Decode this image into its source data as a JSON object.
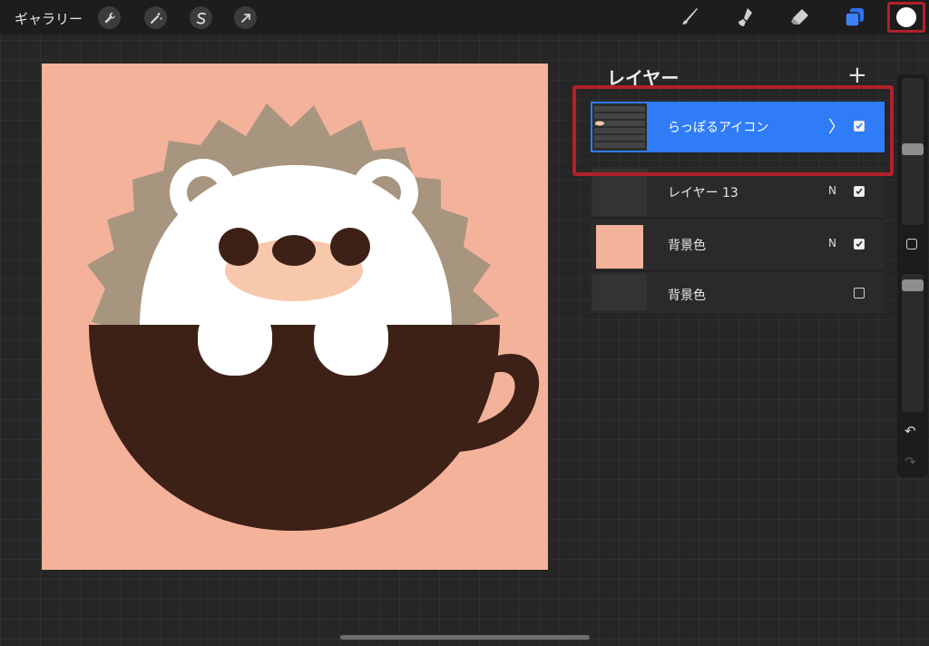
{
  "toolbar": {
    "gallery_label": "ギャラリー",
    "left_tools": [
      "wrench-icon",
      "magic-wand-icon",
      "selection-icon",
      "transform-arrow-icon"
    ],
    "right_tools": [
      "brush-icon",
      "smudge-icon",
      "eraser-icon",
      "layers-icon"
    ],
    "active_tool": "layers-icon",
    "current_color": "#ffffff"
  },
  "layers_panel": {
    "title": "レイヤー",
    "add_label": "+",
    "layers": [
      {
        "name": "らっぽるアイコン",
        "blend": "",
        "checked": true,
        "active": true,
        "type": "group"
      },
      {
        "name": "レイヤー 13",
        "blend": "N",
        "checked": true,
        "active": false,
        "type": "empty"
      },
      {
        "name": "背景色",
        "blend": "N",
        "checked": true,
        "active": false,
        "type": "fill",
        "fill": "#f4b29b"
      },
      {
        "name": "背景色",
        "blend": "",
        "checked": false,
        "active": false,
        "type": "empty"
      }
    ]
  },
  "canvas": {
    "background": "#f4b29b",
    "colors": {
      "spikes": "#a8957f",
      "body": "#ffffff",
      "snout": "#f7c8ac",
      "cup": "#3d2016"
    }
  },
  "sidebar": {
    "undo": "↶",
    "redo": "↷"
  },
  "accent_colors": {
    "active_layer": "#2f7cf6",
    "highlight": "#b3202a",
    "layers_icon": "#2f6ff0"
  }
}
